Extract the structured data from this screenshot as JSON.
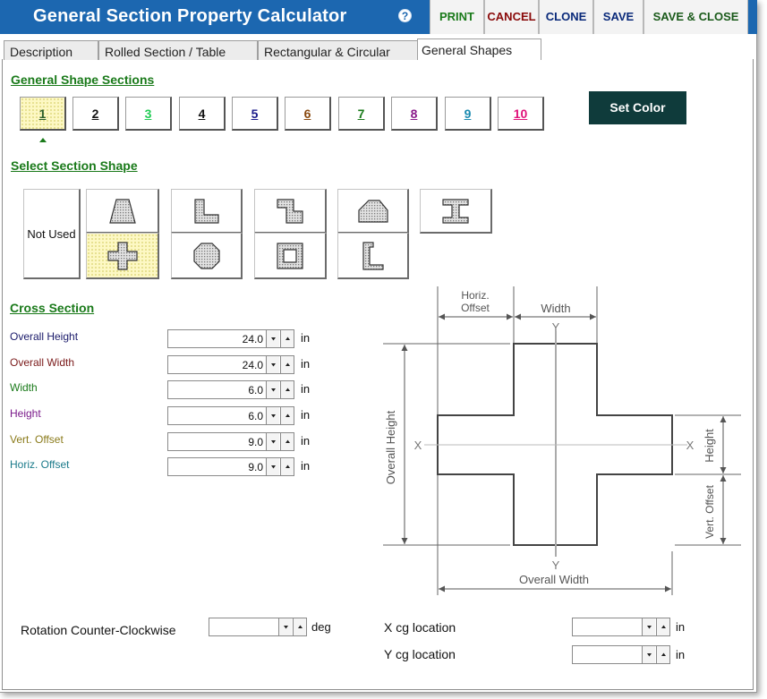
{
  "window": {
    "title": "General Section Property Calculator",
    "help_glyph": "?",
    "buttons": {
      "print": "PRINT",
      "cancel": "CANCEL",
      "clone": "CLONE",
      "save": "SAVE",
      "save_close": "SAVE & CLOSE"
    }
  },
  "tabs": [
    "Description",
    "Rolled Section / Table",
    "Rectangular & Circular",
    "General Shapes"
  ],
  "active_tab": "General Shapes",
  "general_sections": {
    "title": "General Shape Sections",
    "selected": "1",
    "items": [
      {
        "label": "1",
        "color": "#2b5e2b"
      },
      {
        "label": "2",
        "color": "#111111"
      },
      {
        "label": "3",
        "color": "#22cc55"
      },
      {
        "label": "4",
        "color": "#111111"
      },
      {
        "label": "5",
        "color": "#1a1a8a"
      },
      {
        "label": "6",
        "color": "#8a4a10"
      },
      {
        "label": "7",
        "color": "#1a7a1a"
      },
      {
        "label": "8",
        "color": "#8a1a8a"
      },
      {
        "label": "9",
        "color": "#1a8ab0"
      },
      {
        "label": "10",
        "color": "#e0127a"
      }
    ],
    "set_color": "Set Color"
  },
  "select_shape": {
    "title": "Select Section Shape",
    "not_used": "Not Used",
    "shapes": [
      "trapezoid-icon",
      "l-angle-icon",
      "z-section-icon",
      "chamfered-top-icon",
      "i-beam-icon",
      "cross-icon",
      "octagon-icon",
      "hollow-box-icon",
      "channel-icon"
    ],
    "selected": "cross-icon"
  },
  "cross_section": {
    "title": "Cross Section",
    "fields": [
      {
        "label": "Overall Height",
        "value": "24.0",
        "unit": "in",
        "color": "#1a1a6a"
      },
      {
        "label": "Overall Width",
        "value": "24.0",
        "unit": "in",
        "color": "#7a1a1a"
      },
      {
        "label": "Width",
        "value": "6.0",
        "unit": "in",
        "color": "#1a7a1a"
      },
      {
        "label": "Height",
        "value": "6.0",
        "unit": "in",
        "color": "#7a1a8a"
      },
      {
        "label": "Vert. Offset",
        "value": "9.0",
        "unit": "in",
        "color": "#8a7a1a"
      },
      {
        "label": "Horiz. Offset",
        "value": "9.0",
        "unit": "in",
        "color": "#1a7a8a"
      }
    ]
  },
  "diagram": {
    "horiz_offset_line1": "Horiz.",
    "horiz_offset_line2": "Offset",
    "width": "Width",
    "y_top": "Y",
    "y_bottom": "Y",
    "x_left": "X",
    "x_right": "X",
    "overall_height": "Overall Height",
    "height": "Height",
    "vert_offset": "Vert. Offset",
    "overall_width": "Overall Width"
  },
  "bottom": {
    "rotation_label": "Rotation Counter-Clockwise",
    "rotation_value": "",
    "rotation_unit": "deg",
    "x_cg_label": "X cg location",
    "x_cg_value": "",
    "x_cg_unit": "in",
    "y_cg_label": "Y cg location",
    "y_cg_value": "",
    "y_cg_unit": "in"
  }
}
